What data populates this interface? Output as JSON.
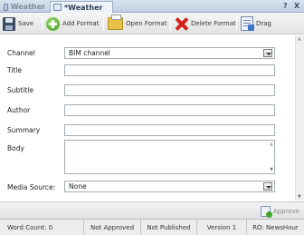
{
  "tabs": [
    {
      "label": "Weather",
      "active": false
    },
    {
      "label": "*Weather",
      "active": true
    }
  ],
  "window_controls": {
    "help": "?",
    "close": "X"
  },
  "toolbar": {
    "save": "Save",
    "add_format": "Add Format",
    "open_format": "Open Format",
    "delete_format": "Delete Format",
    "drag": "Drag"
  },
  "form": {
    "channel": {
      "label": "Channel",
      "value": "BIM channel"
    },
    "title": {
      "label": "Title",
      "value": ""
    },
    "subtitle": {
      "label": "Subtitle",
      "value": ""
    },
    "author": {
      "label": "Author",
      "value": ""
    },
    "summary": {
      "label": "Summary",
      "value": ""
    },
    "body": {
      "label": "Body",
      "value": ""
    },
    "media_source": {
      "label": "Media Source:",
      "value": "None"
    }
  },
  "approve": "Approve",
  "status": {
    "word_count": "Word Count: 0",
    "approval": "Not Approved",
    "publish": "Not Published",
    "version": "Version 1",
    "ro": "RO: NewsHour"
  },
  "colors": {
    "tab_bg": "#c2d0e1",
    "toolbar_bg": "#e3e3e3",
    "delete_red": "#d5231e",
    "add_green": "#3d9a1f"
  }
}
